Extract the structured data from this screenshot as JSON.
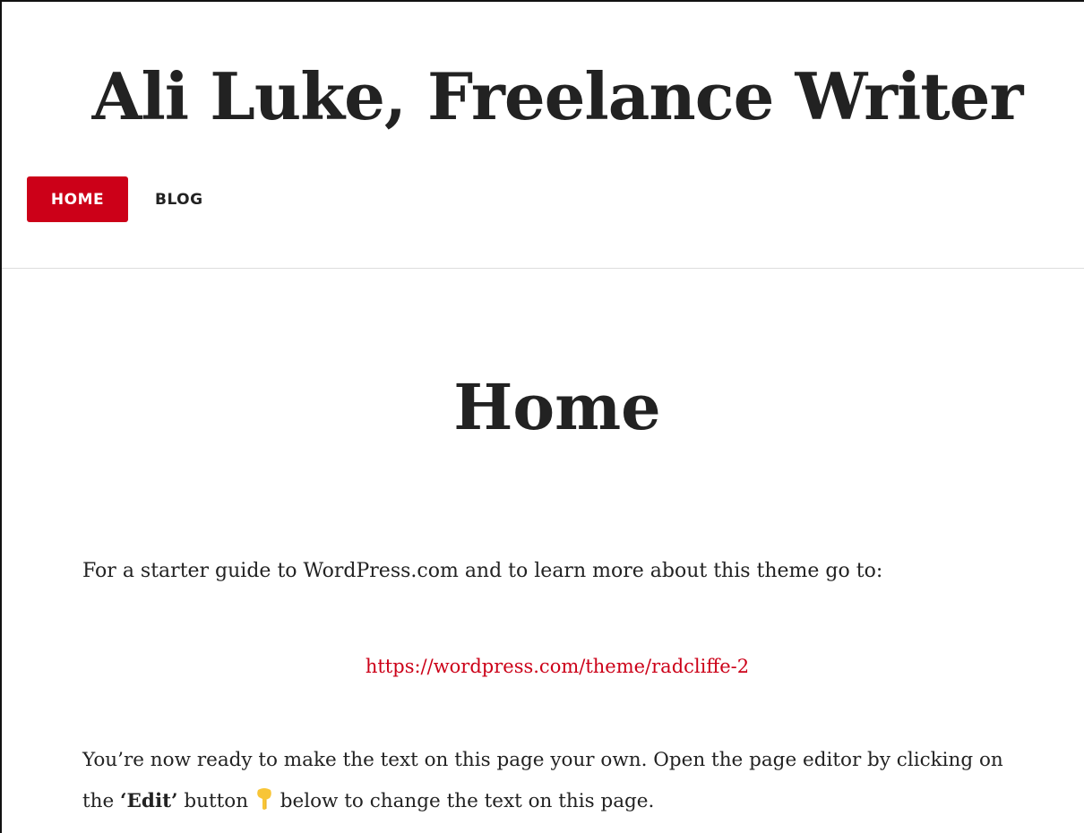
{
  "site": {
    "title": "Ali Luke, Freelance Writer"
  },
  "nav": {
    "items": [
      {
        "label": "HOME",
        "active": true
      },
      {
        "label": "BLOG",
        "active": false
      }
    ]
  },
  "page": {
    "title": "Home",
    "intro": "For a starter guide to WordPress.com and to learn more about this theme go to:",
    "link_text": "https://wordpress.com/theme/radcliffe-2",
    "body_before": "You’re now ready to make the text on this page your own. Open the page editor by clicking on the ",
    "body_bold": "‘Edit’",
    "body_mid": " button ",
    "body_icon": "hand-pointing-down-icon",
    "body_after": " below to change the text on this page."
  },
  "colors": {
    "accent": "#cc0018",
    "text": "#222222",
    "background": "#ffffff",
    "divider": "#dddddd"
  }
}
